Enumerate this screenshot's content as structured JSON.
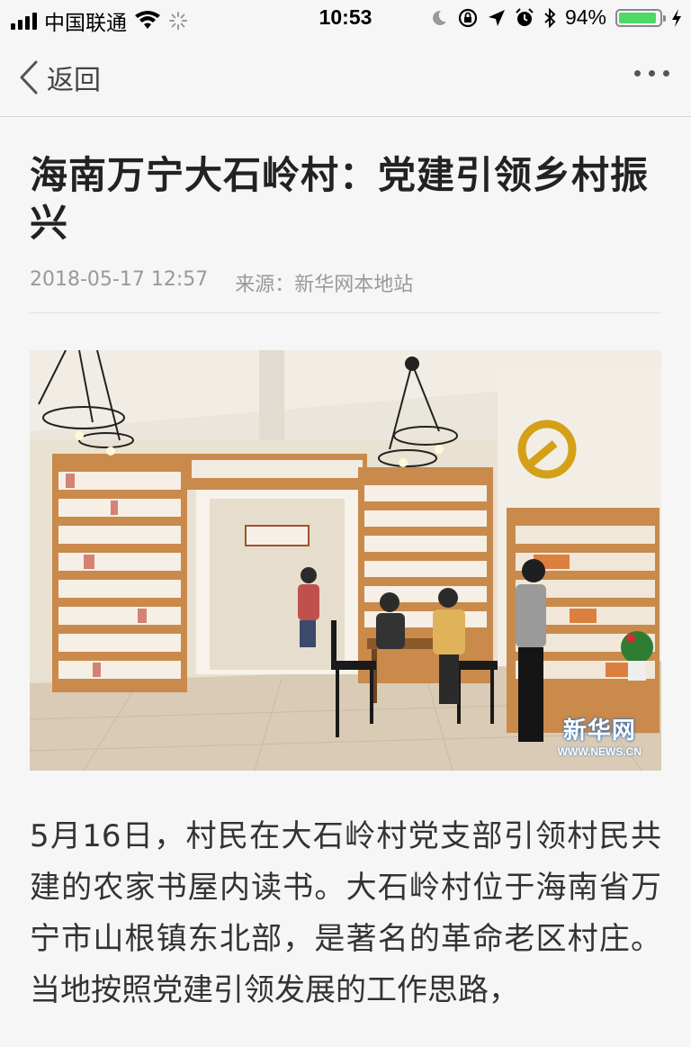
{
  "status_bar": {
    "carrier": "中国联通",
    "time": "10:53",
    "battery_percent": "94%",
    "battery_level": 0.94
  },
  "nav": {
    "back_label": "返回"
  },
  "article": {
    "title": "海南万宁大石岭村：党建引领乡村振兴",
    "date": "2018-05-17 12:57",
    "source": "来源：新华网本地站",
    "photo_watermark_cn": "新华网",
    "photo_watermark_en": "WWW.NEWS.CN",
    "body": "5月16日，村民在大石岭村党支部引领村民共建的农家书屋内读书。大石岭村位于海南省万宁市山根镇东北部，是著名的革命老区村庄。当地按照党建引领发展的工作思路，"
  },
  "colors": {
    "battery_fill": "#4cd964",
    "background": "#f6f6f6"
  }
}
